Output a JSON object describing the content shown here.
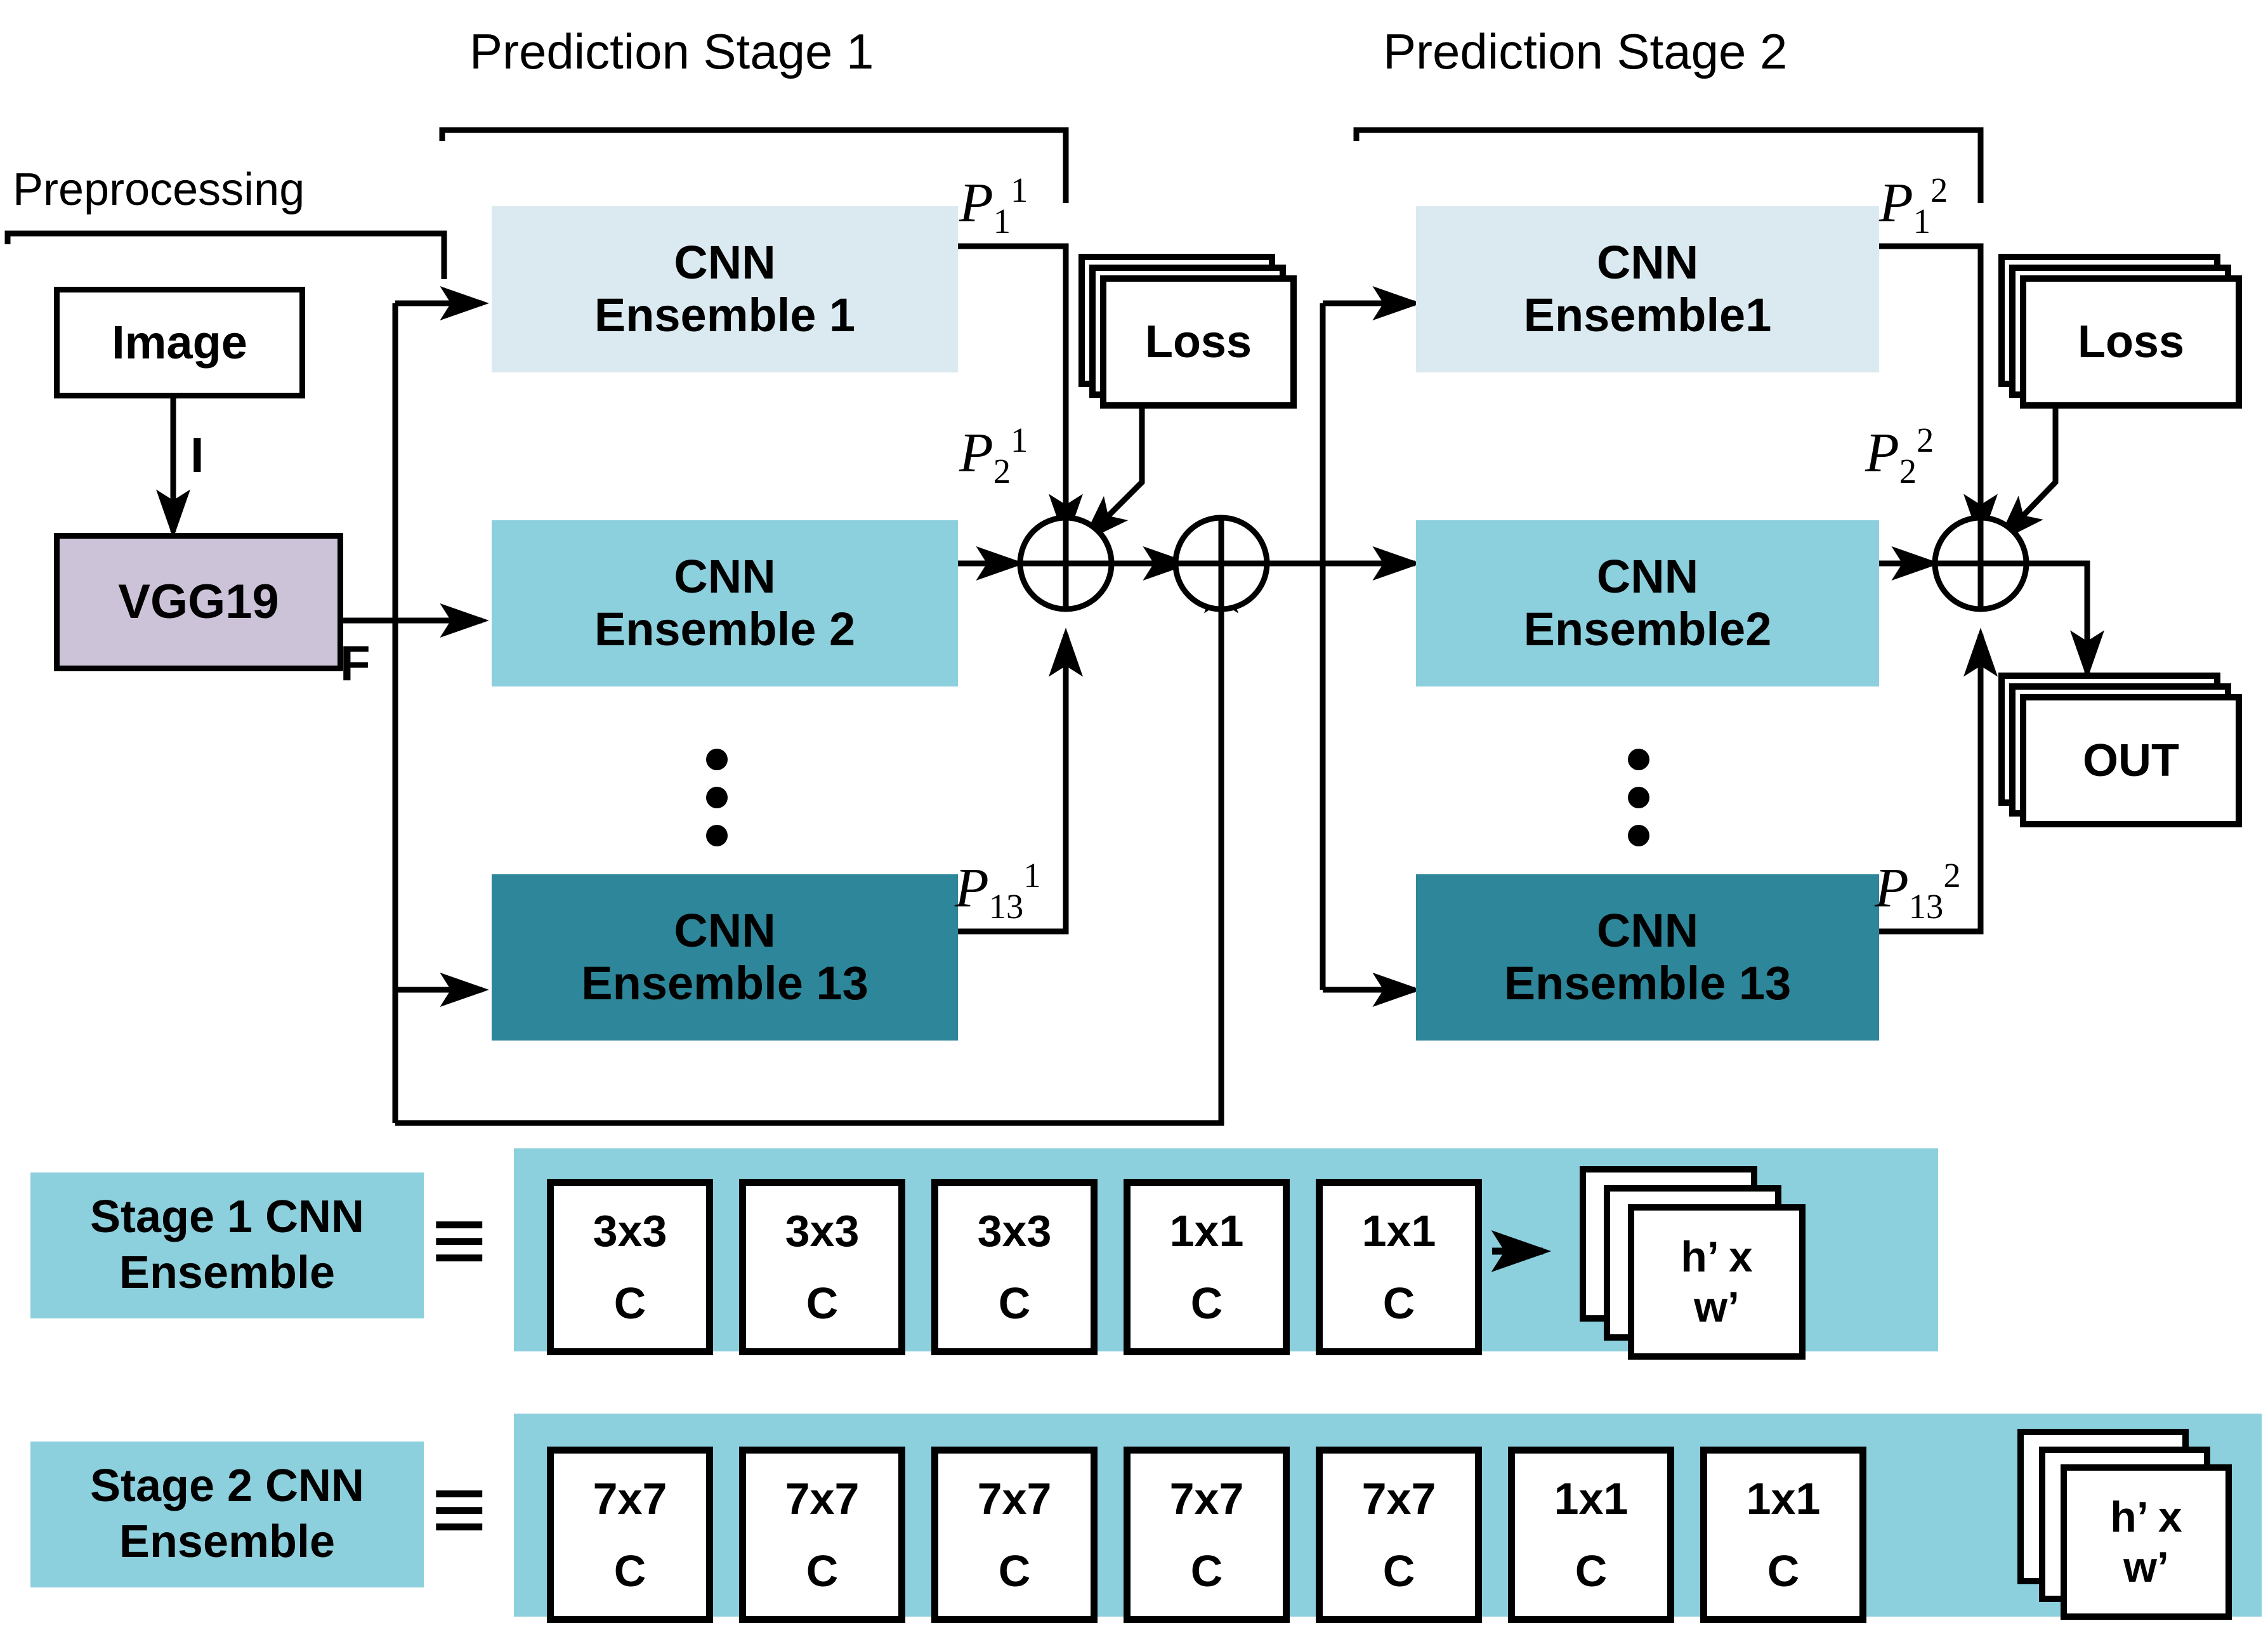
{
  "diagram": {
    "title": "Two-stage CNN ensemble prediction architecture",
    "colors": {
      "ensemble_light": "#dbeaf0",
      "ensemble_medium": "#8ccfdd",
      "ensemble_dark": "#2d8699",
      "vgg_purple": "#cdc3d9",
      "strip_blue": "#8ccfdd",
      "line": "#000000",
      "background": "#ffffff"
    },
    "stage_titles": {
      "preprocessing": "Preprocessing",
      "stage1": "Prediction Stage 1",
      "stage2": "Prediction Stage 2"
    },
    "preprocessing": {
      "image_box": "Image",
      "vgg_box": "VGG19",
      "edge_image_to_vgg": "I",
      "edge_vgg_out": "F"
    },
    "stage1": {
      "ensembles": [
        {
          "line1": "CNN",
          "line2": "Ensemble 1",
          "fill": "#dbeaf0",
          "out": {
            "base": "P",
            "sub": "1",
            "sup": "1"
          }
        },
        {
          "line1": "CNN",
          "line2": "Ensemble 2",
          "fill": "#8ccfdd",
          "out": {
            "base": "P",
            "sub": "2",
            "sup": "1"
          }
        },
        {
          "line1": "CNN",
          "line2": "Ensemble 13",
          "fill": "#2d8699",
          "out": {
            "base": "P",
            "sub": "13",
            "sup": "1"
          }
        }
      ],
      "loss_box": "Loss",
      "vertical_ellipsis": "⋮"
    },
    "stage2": {
      "ensembles": [
        {
          "line1": "CNN",
          "line2": "Ensemble1",
          "fill": "#dbeaf0",
          "out": {
            "base": "P",
            "sub": "1",
            "sup": "2"
          }
        },
        {
          "line1": "CNN",
          "line2": "Ensemble2",
          "fill": "#8ccfdd",
          "out": {
            "base": "P",
            "sub": "2",
            "sup": "2"
          }
        },
        {
          "line1": "CNN",
          "line2": "Ensemble 13",
          "fill": "#2d8699",
          "out": {
            "base": "P",
            "sub": "13",
            "sup": "2"
          }
        }
      ],
      "loss_box": "Loss",
      "out_box": "OUT",
      "vertical_ellipsis": "⋮"
    },
    "legend": [
      {
        "tag_line1": "Stage 1 CNN",
        "tag_line2": "Ensemble",
        "equals": "≡",
        "layers": [
          {
            "kernel": "3x3",
            "op": "C"
          },
          {
            "kernel": "3x3",
            "op": "C"
          },
          {
            "kernel": "3x3",
            "op": "C"
          },
          {
            "kernel": "1x1",
            "op": "C"
          },
          {
            "kernel": "1x1",
            "op": "C"
          }
        ],
        "output_line1": "h’ x",
        "output_line2": "w’"
      },
      {
        "tag_line1": "Stage 2 CNN",
        "tag_line2": "Ensemble",
        "equals": "≡",
        "layers": [
          {
            "kernel": "7x7",
            "op": "C"
          },
          {
            "kernel": "7x7",
            "op": "C"
          },
          {
            "kernel": "7x7",
            "op": "C"
          },
          {
            "kernel": "7x7",
            "op": "C"
          },
          {
            "kernel": "7x7",
            "op": "C"
          },
          {
            "kernel": "1x1",
            "op": "C"
          },
          {
            "kernel": "1x1",
            "op": "C"
          }
        ],
        "output_line1": "h’ x",
        "output_line2": "w’"
      }
    ]
  }
}
